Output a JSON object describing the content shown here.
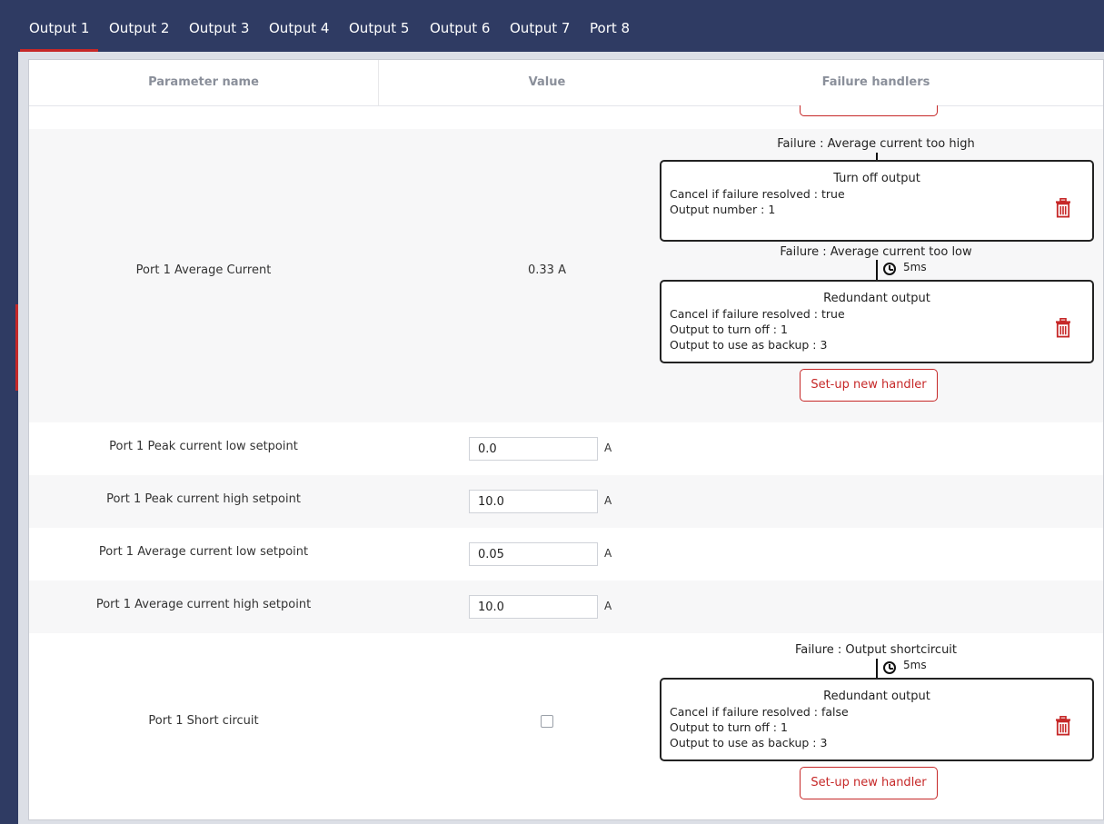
{
  "tabs": [
    {
      "label": "Output 1",
      "active": true
    },
    {
      "label": "Output 2",
      "active": false
    },
    {
      "label": "Output 3",
      "active": false
    },
    {
      "label": "Output 4",
      "active": false
    },
    {
      "label": "Output 5",
      "active": false
    },
    {
      "label": "Output 6",
      "active": false
    },
    {
      "label": "Output 7",
      "active": false
    },
    {
      "label": "Port 8",
      "active": false
    }
  ],
  "table": {
    "headers": {
      "name": "Parameter name",
      "value": "Value",
      "handlers": "Failure handlers"
    },
    "rows": [
      {
        "name": "Port 1 Average Current",
        "value": "0.33 A",
        "failures": [
          {
            "failure": "Failure : Average current too high",
            "handler": {
              "title": "Turn off output",
              "lines": [
                "Cancel if failure resolved : true",
                "Output number : 1"
              ]
            }
          },
          {
            "failure": "Failure : Average current too low",
            "delay": "5ms",
            "handler": {
              "title": "Redundant output",
              "lines": [
                "Cancel if failure resolved : true",
                "Output to turn off : 1",
                "Output to use as backup : 3"
              ]
            }
          }
        ],
        "setup_label": "Set-up new handler"
      },
      {
        "name": "Port 1 Peak current low setpoint",
        "input_value": "0.0",
        "unit": "A"
      },
      {
        "name": "Port 1 Peak current high setpoint",
        "input_value": "10.0",
        "unit": "A"
      },
      {
        "name": "Port 1 Average current low setpoint",
        "input_value": "0.05",
        "unit": "A"
      },
      {
        "name": "Port 1 Average current high setpoint",
        "input_value": "10.0",
        "unit": "A"
      },
      {
        "name": "Port 1 Short circuit",
        "checked": false,
        "failures": [
          {
            "failure": "Failure : Output shortcircuit",
            "delay": "5ms",
            "handler": {
              "title": "Redundant output",
              "lines": [
                "Cancel if failure resolved : false",
                "Output to turn off : 1",
                "Output to use as backup : 3"
              ]
            }
          }
        ],
        "setup_label": "Set-up new handler"
      }
    ]
  },
  "icons": {
    "trash": "trash-icon",
    "clock": "clock-icon"
  },
  "colors": {
    "nav_bg": "#2f3b63",
    "accent_red": "#c62828",
    "row_shaded": "#f7f7f8"
  }
}
